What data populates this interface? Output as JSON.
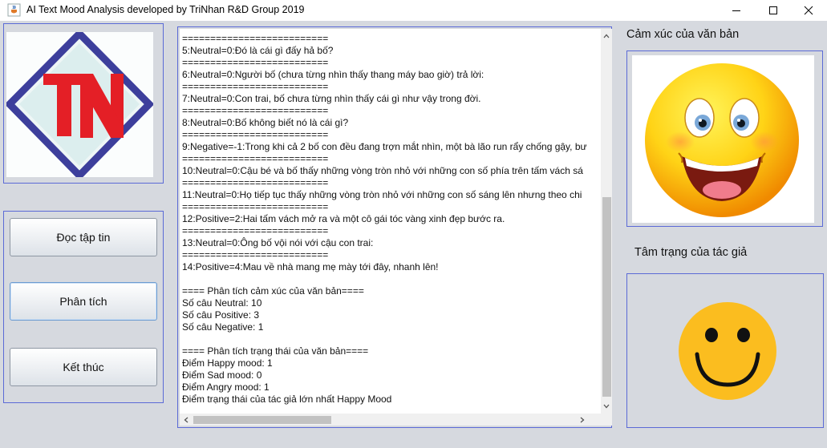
{
  "window": {
    "title": "AI Text Mood Analysis developed by TriNhan R&D Group 2019",
    "app_icon": "java-coffee-icon",
    "controls": [
      "minimize-icon",
      "maximize-icon",
      "close-icon"
    ]
  },
  "logo": {
    "text": "TN",
    "colors": {
      "diamond": "#3d3f9c",
      "letters": "#e41f26"
    }
  },
  "buttons": {
    "read_file": "Đọc tập tin",
    "analyze": "Phân tích",
    "finish": "Kết thúc"
  },
  "output": {
    "lines": [
      "==========================",
      "5:Neutral=0:Đó là cái gì đấy hả bố?",
      "==========================",
      "6:Neutral=0:Người bố (chưa từng nhìn thấy thang máy bao giờ) trả lời:",
      "==========================",
      "7:Neutral=0:Con trai, bố chưa từng nhìn thấy cái gì như vậy trong đời.",
      "==========================",
      "8:Neutral=0:Bố không biết nó là cái gì?",
      "==========================",
      "9:Negative=-1:Trong khi cả 2 bố con đều đang trợn mắt nhìn, một bà lão run rẩy chống gậy, bư",
      "==========================",
      "10:Neutral=0:Cậu bé và bố thấy những vòng tròn nhỏ với những con số phía trên tấm vách sá",
      "==========================",
      "11:Neutral=0:Họ tiếp tục thấy những vòng tròn nhỏ với những con số sáng lên nhưng theo chi",
      "==========================",
      "12:Positive=2:Hai tấm vách mở ra và một cô gái tóc vàng xinh đẹp bước ra.",
      "==========================",
      "13:Neutral=0:Ông bố vội nói với cậu con trai:",
      "==========================",
      "14:Positive=4:Mau về nhà mang mẹ mày tới đây, nhanh lên!",
      "",
      "==== Phân tích cảm xúc của văn bản====",
      " Số câu Neutral: 10",
      " Số câu Positive: 3",
      " Số câu Negative: 1",
      "",
      "==== Phân tích trạng thái của văn bản====",
      " Điểm Happy mood: 1",
      " Điểm Sad mood: 0",
      " Điểm Angry mood: 1",
      " Điểm trạng thái của tác giả lớn nhất Happy Mood"
    ],
    "scroll": {
      "vertical_position": 0.44,
      "horizontal_position": 0.03
    }
  },
  "emotion": {
    "label": "Cảm xúc của văn bản",
    "icon": "laughing-smiley-icon"
  },
  "mood": {
    "label": "Tâm trạng của tác giả",
    "icon": "happy-smiley-icon",
    "color": "#fbbd1f"
  }
}
